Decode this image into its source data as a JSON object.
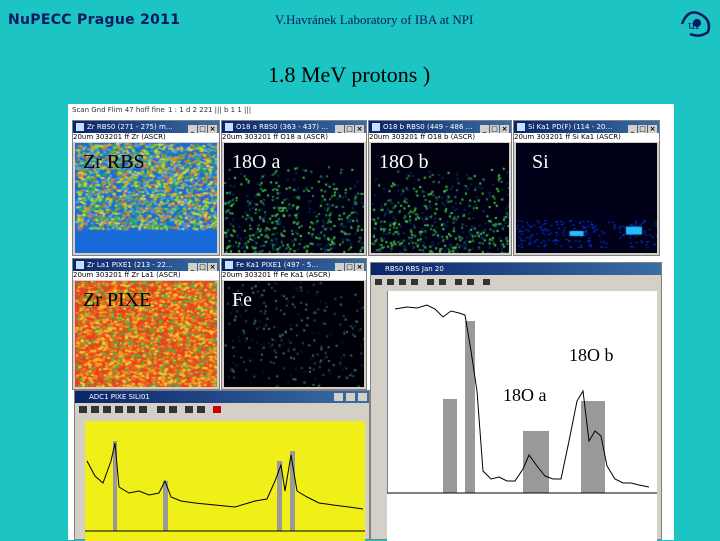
{
  "header": {
    "left": "NuPECC Prague 2011",
    "center": "V.Havránek   Laboratory of IBA at NPI",
    "title": "1.8 MeV protons  )"
  },
  "maps": [
    {
      "id": "zr-rbs",
      "window_title": "Zr RBS0   (271 - 275) m…",
      "sub": "20um  303201 ff   Zr (ASCR)",
      "label": "Zr  RBS",
      "label_color": "#000000"
    },
    {
      "id": "18o-a",
      "window_title": "O18 a RBS0  (363 - 437) …",
      "sub": "20um  303201 ff   O18 a (ASCR)",
      "label": "18O  a",
      "label_color": "#ffffff"
    },
    {
      "id": "18o-b",
      "window_title": "O18 b RBS0  (449 - 486 …",
      "sub": "20um  303201 ff   O18 b (ASCR)",
      "label": "18O  b",
      "label_color": "#ffffff"
    },
    {
      "id": "si",
      "window_title": "Si Ka1 PD(F)  (114 - 20…",
      "sub": "20um  303201 ff   Si Ka1 (ASCR)",
      "label": "Si",
      "label_color": "#ffffff"
    },
    {
      "id": "zr-pixe",
      "window_title": "Zr La1 PIXE1  (213 - 22…",
      "sub": "20um  303201 ff   Zr La1 (ASCR)",
      "label": "Zr  PIXE",
      "label_color": "#000000"
    },
    {
      "id": "fe",
      "window_title": "Fe Ka1 PIXE1  (497 - 5…",
      "sub": "20um  303201 ff   Fe Ka1 (ASCR)",
      "label": "Fe",
      "label_color": "#ffffff"
    }
  ],
  "spectrum_window": {
    "title": "RBS0 RBS  Jan 20",
    "peak_label_b": "18O  b",
    "peak_label_a": "18O  a"
  },
  "adc_window": {
    "title": "ADC1  PIXE  SILI01"
  },
  "menu_strip": {
    "a": "Scan Gnd Flim 47 hoff fine",
    "b": "1 : 1 d 2 22",
    "c": "1 ||| b 1 1 |||"
  }
}
